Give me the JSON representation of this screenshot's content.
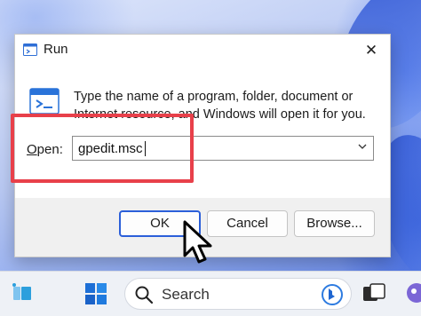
{
  "dialog": {
    "title": "Run",
    "description": "Type the name of a program, folder, document or Internet resource, and Windows will open it for you.",
    "open_label": "Open:",
    "open_value": "gpedit.msc",
    "buttons": {
      "ok": "OK",
      "cancel": "Cancel",
      "browse": "Browse..."
    },
    "icons": {
      "title": "run-icon",
      "body": "run-icon",
      "close": "close-icon",
      "dropdown": "chevron-down-icon"
    }
  },
  "taskbar": {
    "search_placeholder": "Search",
    "icons": [
      "widgets-icon",
      "start-icon",
      "search-icon",
      "bing-icon",
      "task-view-icon",
      "chat-icon"
    ]
  },
  "colors": {
    "highlight": "#e8404a",
    "accent": "#2b5fd9"
  }
}
